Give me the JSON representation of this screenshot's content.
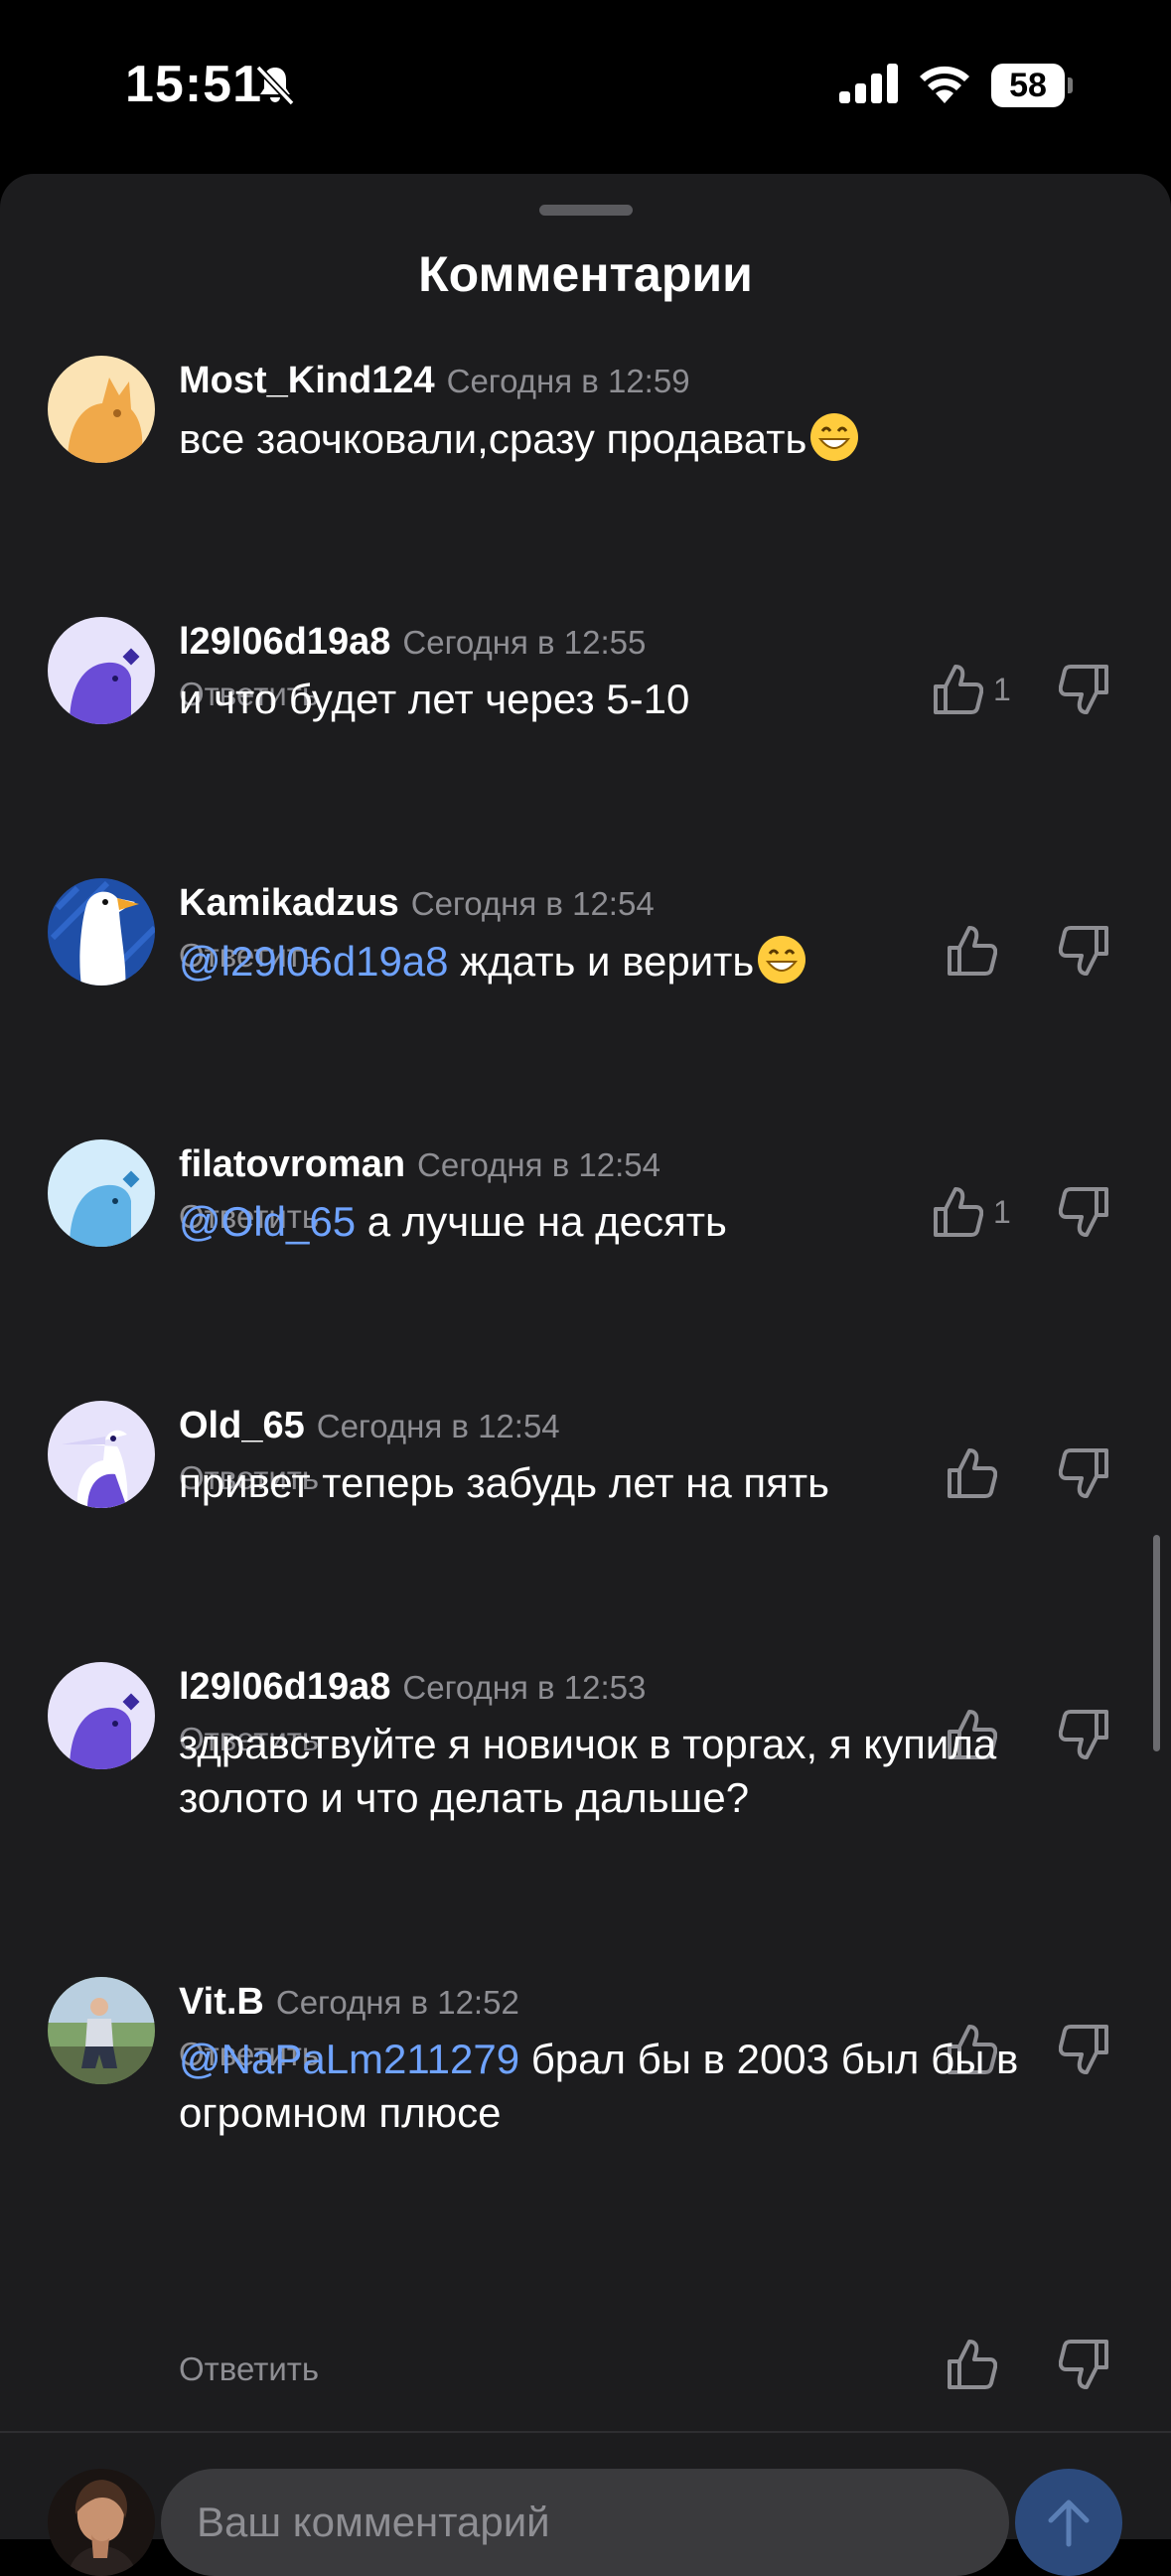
{
  "status": {
    "time": "15:51",
    "battery": "58"
  },
  "sheet": {
    "title": "Комментарии"
  },
  "comments": [
    {
      "author": "Most_Kind124",
      "time": "Сегодня в 12:59",
      "mention": "",
      "text": "все заочковали,сразу продавать",
      "reply": "Ответить",
      "likes": "1"
    },
    {
      "author": "l29l06d19a8",
      "time": "Сегодня в 12:55",
      "mention": "",
      "text": "и что будет лет через 5-10",
      "reply": "Ответить",
      "likes": ""
    },
    {
      "author": "Kamikadzus",
      "time": "Сегодня в 12:54",
      "mention": "@l29l06d19a8",
      "text": " ждать и верить",
      "reply": "Ответить",
      "likes": "1"
    },
    {
      "author": "filatovroman",
      "time": "Сегодня в 12:54",
      "mention": "@Old_65",
      "text": " а лучше на десять",
      "reply": "Ответить",
      "likes": ""
    },
    {
      "author": "Old_65",
      "time": "Сегодня в 12:54",
      "mention": "",
      "text": "привет теперь забудь лет на пять",
      "reply": "Ответить",
      "likes": ""
    },
    {
      "author": "l29l06d19a8",
      "time": "Сегодня в 12:53",
      "mention": "",
      "text": "здравствуйте я новичок в торгах, я купила золото и что делать дальше?",
      "reply": "Ответить",
      "likes": ""
    },
    {
      "author": "Vit.B",
      "time": "Сегодня в 12:52",
      "mention": "@NaPaLm211279",
      "text": " брал бы в 2003 был бы в огромном плюсе",
      "reply": "Ответить",
      "likes": ""
    }
  ],
  "composer": {
    "placeholder": "Ваш комментарий"
  },
  "colors": {
    "background": "#1c1c1e",
    "mention": "#6fa3ff",
    "muted": "#8e8e93",
    "send": "#2c4a7c"
  },
  "icons": [
    "bell-slash-icon",
    "cellular-signal-icon",
    "wifi-icon",
    "battery-icon",
    "thumbs-up-icon",
    "thumbs-down-icon",
    "grinning-emoji-icon",
    "arrow-up-icon"
  ]
}
